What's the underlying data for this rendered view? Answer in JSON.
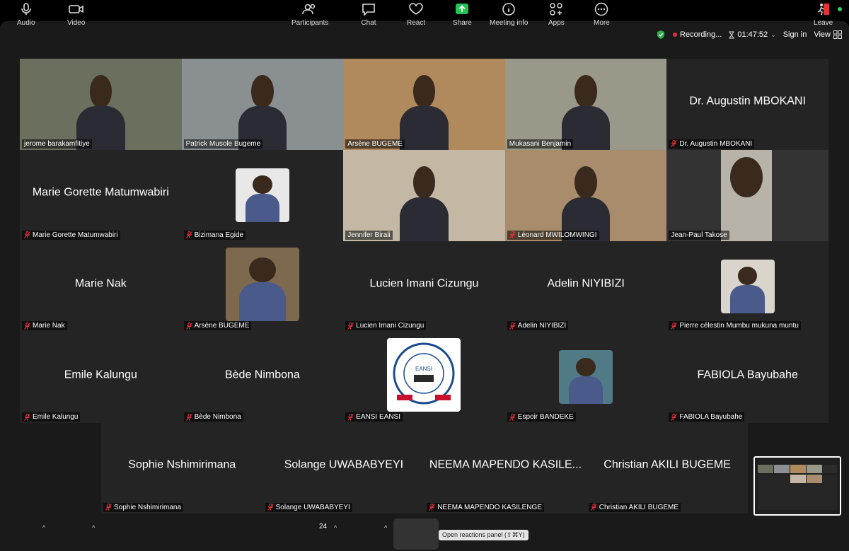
{
  "topbar": {
    "recording": "Recording...",
    "timer": "01:47:52",
    "signin": "Sign in",
    "view": "View"
  },
  "tiles": [
    {
      "label": "jerome barakamfitiye",
      "center": "",
      "muted": false,
      "kind": "video",
      "bg": "#6a6f5e"
    },
    {
      "label": "Patrick Musole Bugeme",
      "center": "",
      "muted": false,
      "kind": "video",
      "bg": "#8a8f92"
    },
    {
      "label": "Arsène BUGEME",
      "center": "",
      "muted": false,
      "kind": "video",
      "bg": "#b08a5c"
    },
    {
      "label": "Mukasani Benjamin",
      "center": "",
      "muted": false,
      "kind": "video",
      "bg": "#9a9888"
    },
    {
      "label": "Dr. Augustin MBOKANI",
      "center": "Dr. Augustin MBOKANI",
      "muted": true,
      "kind": "name"
    },
    {
      "label": "Marie Gorette Matumwabiri",
      "center": "Marie Gorette Matumwabiri",
      "muted": true,
      "kind": "name"
    },
    {
      "label": "Bizimana Egide",
      "center": "",
      "muted": true,
      "kind": "avatar",
      "bg": "#e8e8e8"
    },
    {
      "label": "Jennifer Birali",
      "center": "",
      "muted": false,
      "kind": "video",
      "bg": "#c4b8a4"
    },
    {
      "label": "Léonard MWILOMWINGI",
      "center": "",
      "muted": true,
      "kind": "video",
      "bg": "#a88c6c"
    },
    {
      "label": "Jean-Paul Takose",
      "center": "",
      "muted": false,
      "kind": "video-narrow",
      "bg": "#b7b3a8"
    },
    {
      "label": "Marie Nak",
      "center": "Marie Nak",
      "muted": true,
      "kind": "name"
    },
    {
      "label": "Arsène BUGEME",
      "center": "",
      "muted": true,
      "kind": "avatar-lg",
      "bg": "#7d6a4e"
    },
    {
      "label": "Lucien Imani Cizungu",
      "center": "Lucien Imani Cizungu",
      "muted": true,
      "kind": "name"
    },
    {
      "label": "Adelin NIYIBIZI",
      "center": "Adelin NIYIBIZI",
      "muted": true,
      "kind": "name"
    },
    {
      "label": "Pierre célestin Mumbu mukuna muntu",
      "center": "",
      "muted": true,
      "kind": "avatar",
      "bg": "#d9d5cc"
    },
    {
      "label": "Emile Kalungu",
      "center": "Emile Kalungu",
      "muted": true,
      "kind": "name"
    },
    {
      "label": "Bède Nimbona",
      "center": "Bède Nimbona",
      "muted": true,
      "kind": "name"
    },
    {
      "label": "EANSI EANSI",
      "center": "",
      "muted": true,
      "kind": "logo",
      "bg": "#ffffff"
    },
    {
      "label": "Espoir BANDEKE",
      "center": "",
      "muted": true,
      "kind": "avatar",
      "bg": "#4f7a86"
    },
    {
      "label": "FABIOLA Bayubahe",
      "center": "FABIOLA Bayubahe",
      "muted": true,
      "kind": "name"
    }
  ],
  "bottom_tiles": [
    {
      "label": "Sophie Nshimirimana",
      "center": "Sophie Nshimirimana",
      "muted": true
    },
    {
      "label": "Solange UWABABYEYI",
      "center": "Solange UWABABYEYI",
      "muted": true
    },
    {
      "label": "NEEMA MAPENDO KASILENGE",
      "center": "NEEMA MAPENDO KASILE...",
      "muted": true
    },
    {
      "label": "Christian AKILI BUGEME",
      "center": "Christian AKILI BUGEME",
      "muted": true
    }
  ],
  "logo_text": {
    "top": "EAST AFRICAN NUTRITIONAL SCIENCES INSTITUTE",
    "mid": "EANSI",
    "left_ribbon": "UNITED",
    "right_ribbon": "NUTRITION",
    "bottom": "FOR"
  },
  "toolbar": {
    "audio": "Audio",
    "video": "Video",
    "participants": "Participants",
    "participants_count": "24",
    "chat": "Chat",
    "react": "React",
    "share": "Share",
    "meeting_info": "Meeting info",
    "apps": "Apps",
    "more": "More",
    "leave": "Leave",
    "tooltip": "Open reactions panel (⇧⌘Y)"
  },
  "colors": {
    "window": "#1a1a1a",
    "tile": "#242424",
    "record_red": "#e8303a",
    "shield_green": "#2bb24c",
    "share_green": "#23c552",
    "leave_red": "#e8303a"
  }
}
